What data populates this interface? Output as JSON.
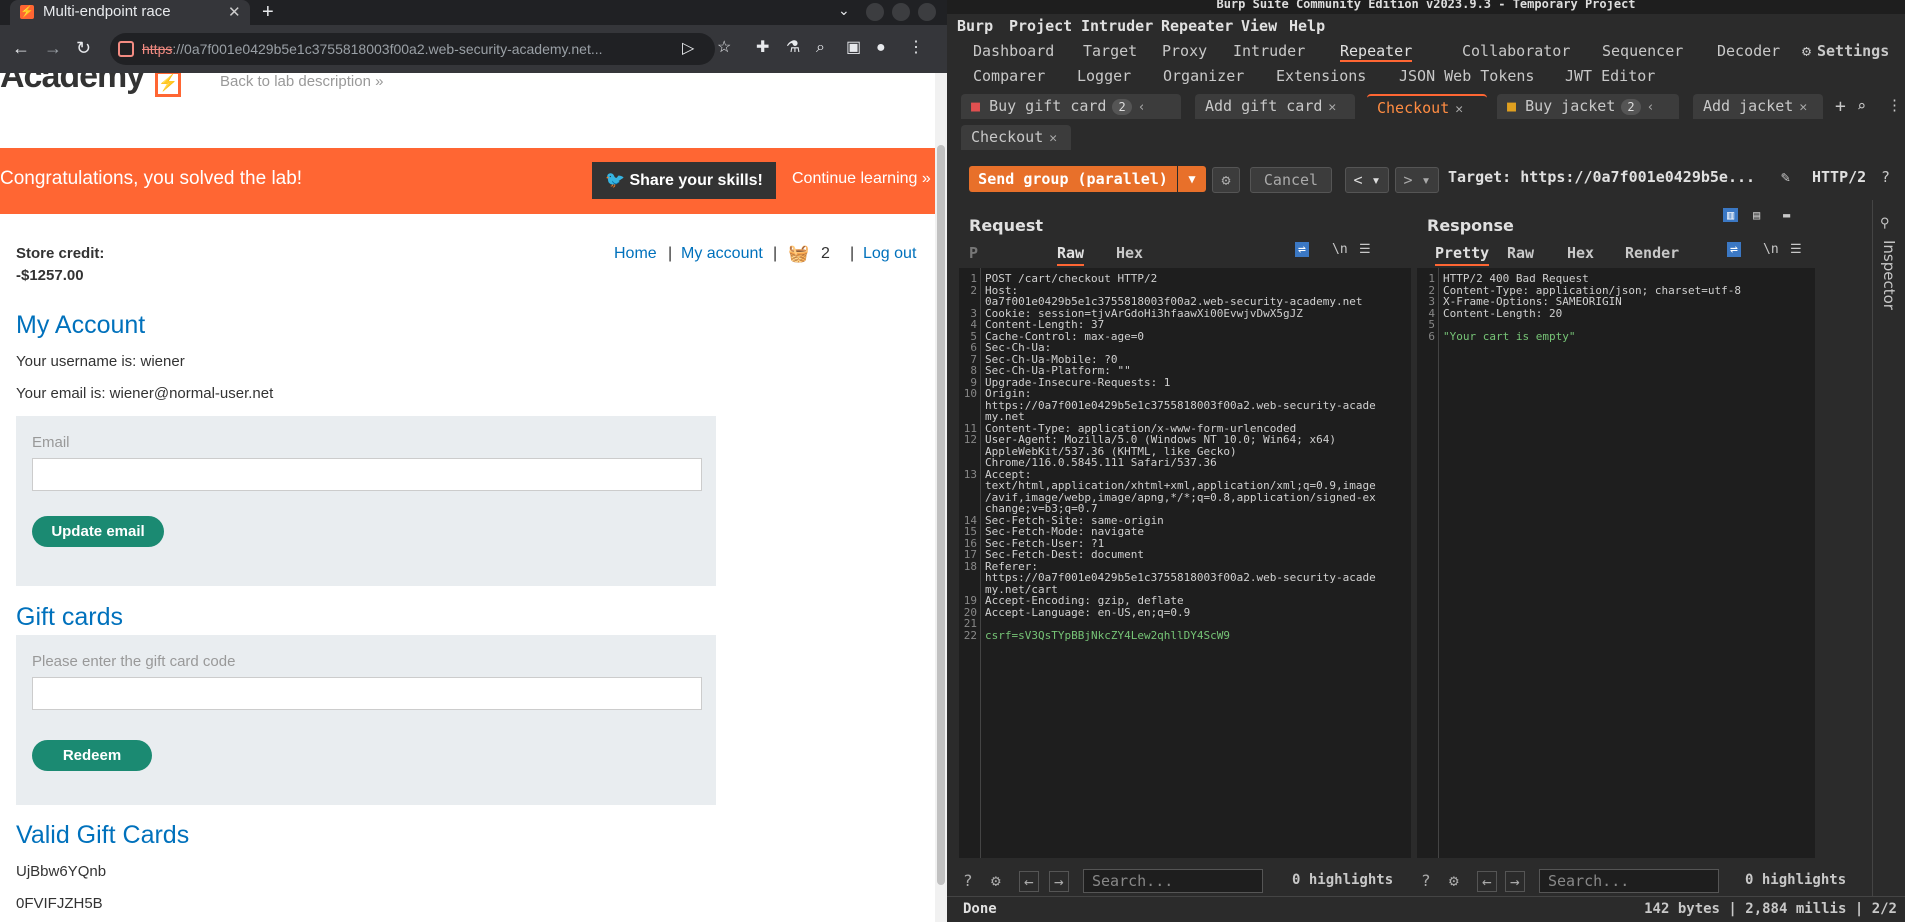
{
  "browser": {
    "tab_title": "Multi-endpoint race",
    "url_scheme": "https",
    "url_rest": "://0a7f001e0429b5e1c3755818003f00a2.web-security-academy.net..."
  },
  "lab": {
    "logo_text": "Academy",
    "back_to_lab": "Back to lab description",
    "banner_message": "Congratulations, you solved the lab!",
    "share_button": "Share your skills!",
    "continue_learning": "Continue learning",
    "store_credit_label": "Store credit:",
    "store_credit_value": "-$1257.00",
    "nav": {
      "home": "Home",
      "my_account": "My account",
      "cart_count": "2",
      "logout": "Log out"
    },
    "my_account_title": "My Account",
    "username_line": "Your username is: wiener",
    "email_line": "Your email is: wiener@normal-user.net",
    "email_placeholder": "Email",
    "update_email_button": "Update email",
    "gift_cards_title": "Gift cards",
    "gift_card_placeholder": "Please enter the gift card code",
    "redeem_button": "Redeem",
    "valid_gift_cards_title": "Valid Gift Cards",
    "gift_codes": [
      "UjBbw6YQnb",
      "0FVIFJZH5B"
    ]
  },
  "burp": {
    "window_title": "Burp Suite Community Edition v2023.9.3 - Temporary Project",
    "menu": [
      "Burp",
      "Project",
      "Intruder",
      "Repeater",
      "View",
      "Help"
    ],
    "tool_tabs_row1": [
      "Dashboard",
      "Target",
      "Proxy",
      "Intruder",
      "Repeater",
      "Collaborator",
      "Sequencer",
      "Decoder"
    ],
    "settings_label": "Settings",
    "tool_tabs_row2": [
      "Comparer",
      "Logger",
      "Organizer",
      "Extensions",
      "JSON Web Tokens",
      "JWT Editor"
    ],
    "repeater_tabs": [
      {
        "label": "Buy gift card",
        "badge": "2"
      },
      {
        "label": "Add gift card"
      },
      {
        "label": "Checkout"
      },
      {
        "label": "Buy jacket",
        "badge": "2"
      },
      {
        "label": "Add jacket"
      },
      {
        "label": "Checkout"
      }
    ],
    "send_group_button": "Send group (parallel)",
    "cancel_button": "Cancel",
    "target": "Target: https://0a7f001e0429b5e...",
    "http_version": "HTTP/2",
    "request": {
      "title": "Request",
      "tabs": [
        "Raw",
        "Hex"
      ],
      "lines": [
        [
          "1",
          "POST /cart/checkout HTTP/2"
        ],
        [
          "2",
          "Host:"
        ],
        [
          "",
          "0a7f001e0429b5e1c3755818003f00a2.web-security-academy.net"
        ],
        [
          "3",
          "Cookie: session=tjvArGdoHi3hfaawXi00EvwjvDwX5gJZ"
        ],
        [
          "4",
          "Content-Length: 37"
        ],
        [
          "5",
          "Cache-Control: max-age=0"
        ],
        [
          "6",
          "Sec-Ch-Ua:"
        ],
        [
          "7",
          "Sec-Ch-Ua-Mobile: ?0"
        ],
        [
          "8",
          "Sec-Ch-Ua-Platform: \"\""
        ],
        [
          "9",
          "Upgrade-Insecure-Requests: 1"
        ],
        [
          "10",
          "Origin:"
        ],
        [
          "",
          "https://0a7f001e0429b5e1c3755818003f00a2.web-security-acade"
        ],
        [
          "",
          "my.net"
        ],
        [
          "11",
          "Content-Type: application/x-www-form-urlencoded"
        ],
        [
          "12",
          "User-Agent: Mozilla/5.0 (Windows NT 10.0; Win64; x64)"
        ],
        [
          "",
          "AppleWebKit/537.36 (KHTML, like Gecko)"
        ],
        [
          "",
          "Chrome/116.0.5845.111 Safari/537.36"
        ],
        [
          "13",
          "Accept:"
        ],
        [
          "",
          "text/html,application/xhtml+xml,application/xml;q=0.9,image"
        ],
        [
          "",
          "/avif,image/webp,image/apng,*/*;q=0.8,application/signed-ex"
        ],
        [
          "",
          "change;v=b3;q=0.7"
        ],
        [
          "14",
          "Sec-Fetch-Site: same-origin"
        ],
        [
          "15",
          "Sec-Fetch-Mode: navigate"
        ],
        [
          "16",
          "Sec-Fetch-User: ?1"
        ],
        [
          "17",
          "Sec-Fetch-Dest: document"
        ],
        [
          "18",
          "Referer:"
        ],
        [
          "",
          "https://0a7f001e0429b5e1c3755818003f00a2.web-security-acade"
        ],
        [
          "",
          "my.net/cart"
        ],
        [
          "19",
          "Accept-Encoding: gzip, deflate"
        ],
        [
          "20",
          "Accept-Language: en-US,en;q=0.9"
        ],
        [
          "21",
          ""
        ],
        [
          "22",
          "csrf=sV3QsTYpBBjNkcZY4Lew2qhllDY4ScW9"
        ]
      ],
      "search_placeholder": "Search...",
      "highlights": "0 highlights"
    },
    "response": {
      "title": "Response",
      "tabs": [
        "Pretty",
        "Raw",
        "Hex",
        "Render"
      ],
      "lines": [
        [
          "1",
          "HTTP/2 400 Bad Request"
        ],
        [
          "2",
          "Content-Type: application/json; charset=utf-8"
        ],
        [
          "3",
          "X-Frame-Options: SAMEORIGIN"
        ],
        [
          "4",
          "Content-Length: 20"
        ],
        [
          "5",
          ""
        ],
        [
          "6",
          "\"Your cart is empty\""
        ]
      ],
      "search_placeholder": "Search...",
      "highlights": "0 highlights"
    },
    "inspector_label": "Inspector",
    "status_left": "Done",
    "status_right": "142 bytes | 2,884 millis | 2/2"
  }
}
